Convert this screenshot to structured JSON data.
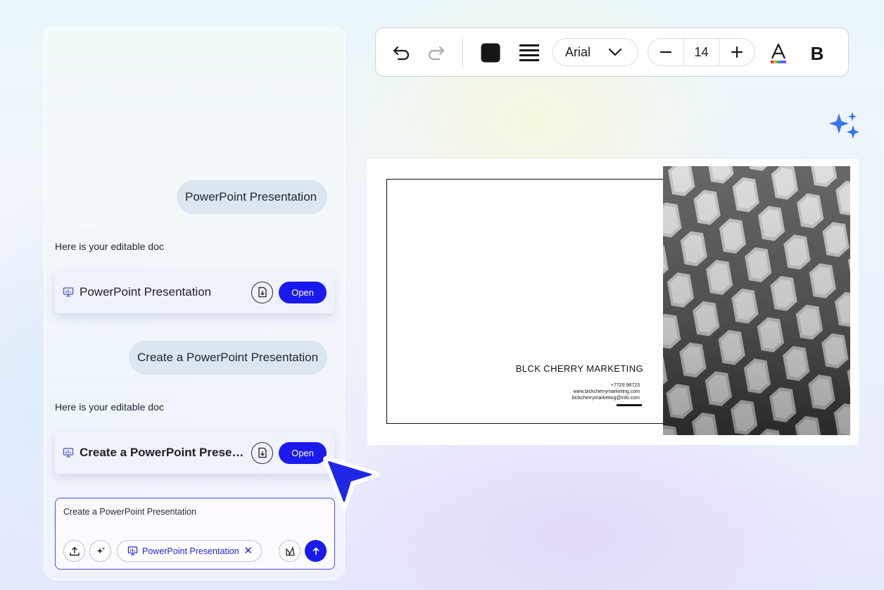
{
  "chat": {
    "messages": [
      {
        "role": "user",
        "text": "PowerPoint Presentation"
      },
      {
        "role": "assistant",
        "text": "Here is your editable doc",
        "doc_title": "PowerPoint Presentation",
        "open_label": "Open"
      },
      {
        "role": "user",
        "text": "Create a PowerPoint Presentation"
      },
      {
        "role": "assistant",
        "text": "Here is your editable doc",
        "doc_title": "Create a PowerPoint Presentation",
        "open_label": "Open"
      }
    ]
  },
  "composer": {
    "value": "Create a PowerPoint Presentation",
    "chip_label": "PowerPoint Presentation",
    "chip_close": "✕"
  },
  "toolbar": {
    "font_family": "Arial",
    "font_size": "14",
    "bold_label": "B",
    "minus_label": "−",
    "plus_label": "+"
  },
  "slide": {
    "company": "BLCK CHERRY MARKETING",
    "phone": "+7729 98723",
    "website": "www.bickcherrymarketing.com",
    "email": "bickcherrymarketing@info.com"
  },
  "colors": {
    "accent": "#1a1aee",
    "bubble": "#dbe6f1",
    "sparkle": "#3b74f0"
  },
  "icons": {
    "undo": "undo-icon",
    "redo": "redo-icon",
    "fill": "fill-color-icon",
    "align": "align-justify-icon",
    "dropdown": "chevron-down-icon",
    "text_color": "text-color-icon",
    "bold": "bold-icon",
    "download": "download-icon",
    "upload": "upload-icon",
    "magic": "sparkle-icon",
    "presentation": "presentation-icon",
    "send": "arrow-up-icon",
    "shapes": "shapes-icon",
    "cursor": "cursor-arrow-icon"
  }
}
